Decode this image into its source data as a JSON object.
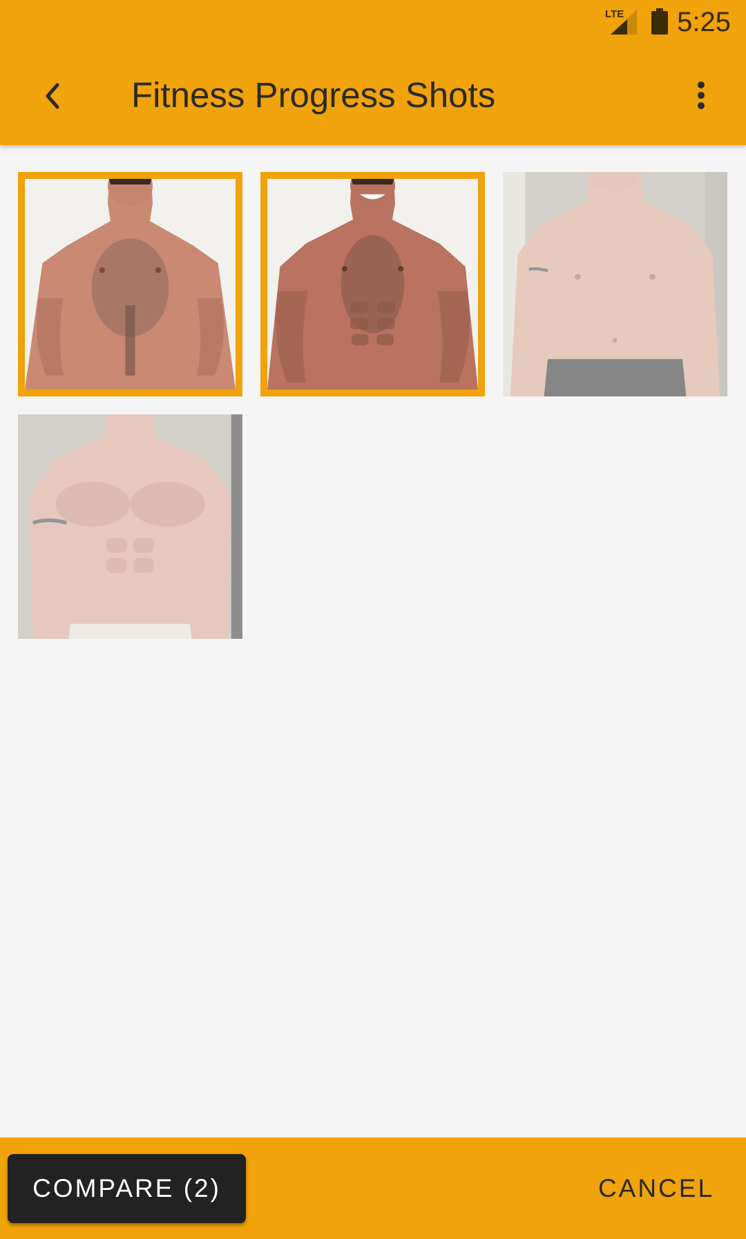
{
  "status_bar": {
    "network": "LTE",
    "time": "5:25",
    "icons": [
      "lte-signal-icon",
      "battery-icon"
    ]
  },
  "app_bar": {
    "title": "Fitness Progress Shots",
    "icons": [
      "back-arrow-icon",
      "more-vert-icon"
    ]
  },
  "theme": {
    "accent": "#f0a30a",
    "button_dark": "#222222",
    "background": "#f5f5f5"
  },
  "photos": [
    {
      "selected": true
    },
    {
      "selected": true
    },
    {
      "selected": false
    },
    {
      "selected": false
    }
  ],
  "bottom_bar": {
    "compare_label": "COMPARE (2)",
    "cancel_label": "CANCEL"
  }
}
